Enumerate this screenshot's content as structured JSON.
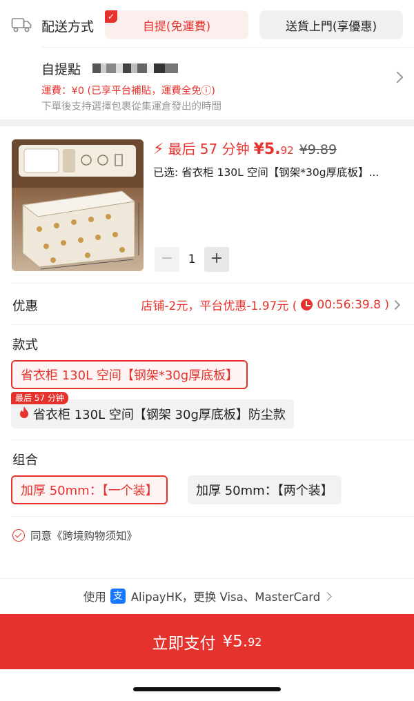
{
  "delivery": {
    "label": "配送方式",
    "options": [
      {
        "label": "自提(免運費)",
        "selected": true
      },
      {
        "label": "送貨上門(享優惠)",
        "selected": false
      }
    ],
    "check_mark": "✓"
  },
  "pickup": {
    "title": "自提點",
    "fee": "運費：¥0 (已享平台補貼，運費全免ⓘ)",
    "note": "下單後支持選擇包裹從集運倉發出的時間"
  },
  "product": {
    "bolt": "⚡",
    "countdown_label": "最后 57 分钟",
    "price_currency_int": "¥5.",
    "price_decimal": "92",
    "price_original": "¥9.89",
    "selected_spec": "已选: 省衣柜 130L 空间【钢架*30g厚底板】...",
    "quantity": {
      "minus": "−",
      "value": "1",
      "plus": "+"
    }
  },
  "discount": {
    "label": "优惠",
    "detail": "店铺-2元，平台优惠-1.97元 (",
    "timer": "00:56:39.8 )"
  },
  "style": {
    "label": "款式",
    "options": [
      {
        "label": "省衣柜 130L 空间【钢架*30g厚底板】",
        "selected": true
      },
      {
        "label": "省衣柜 130L 空间【钢架 30g厚底板】防尘款",
        "selected": false,
        "tag": "最后 57 分钟",
        "icon": "flame-icon"
      }
    ]
  },
  "combo": {
    "label": "组合",
    "options": [
      {
        "label": "加厚 50mm：【一个装】",
        "selected": true
      },
      {
        "label": "加厚 50mm：【两个装】",
        "selected": false
      }
    ]
  },
  "agreement": {
    "text": "同意《跨境购物须知》"
  },
  "payment": {
    "prefix": "使用",
    "method": "AlipayHK，更换 Visa、MasterCard",
    "button_label": "立即支付",
    "button_price_int": "¥5.",
    "button_price_dec": "92"
  },
  "colors": {
    "accent": "#e5322d",
    "alipay": "#1677ff"
  }
}
